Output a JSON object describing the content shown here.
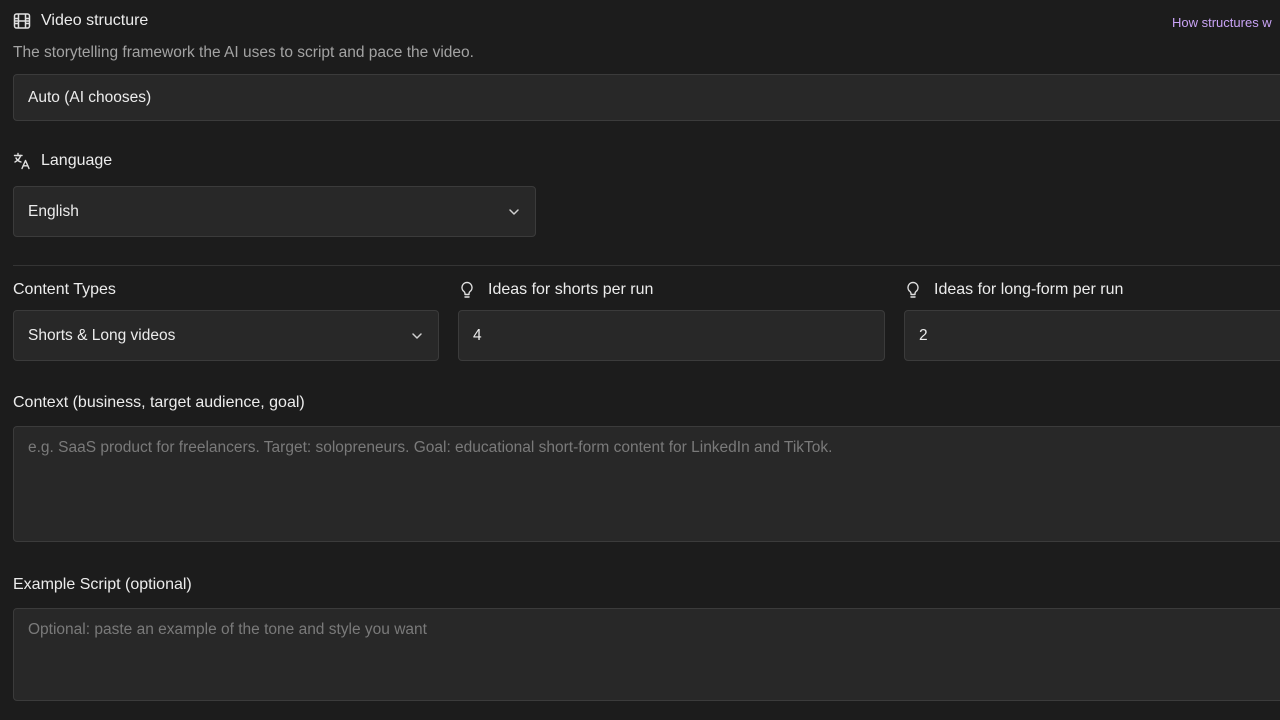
{
  "video_structure": {
    "title": "Video structure",
    "description": "The storytelling framework the AI uses to script and pace the video.",
    "help_link": "How structures w",
    "value": "Auto (AI chooses)"
  },
  "language": {
    "title": "Language",
    "value": "English"
  },
  "content_types": {
    "label": "Content Types",
    "value": "Shorts & Long videos"
  },
  "ideas_shorts": {
    "label": "Ideas for shorts per run",
    "value": "4"
  },
  "ideas_long": {
    "label": "Ideas for long-form per run",
    "value": "2"
  },
  "context": {
    "label": "Context (business, target audience, goal)",
    "placeholder": "e.g. SaaS product for freelancers. Target: solopreneurs. Goal: educational short-form content for LinkedIn and TikTok."
  },
  "example_script": {
    "label": "Example Script (optional)",
    "placeholder": "Optional: paste an example of the tone and style you want"
  },
  "icons": {
    "video_structure": "film-icon",
    "language": "translate-icon",
    "ideas": "lightbulb-icon",
    "select": "chevron-down-icon"
  },
  "colors": {
    "background": "#1c1c1c",
    "field_background": "#282828",
    "border": "#3b3b3b",
    "link": "#c9a3f5"
  }
}
